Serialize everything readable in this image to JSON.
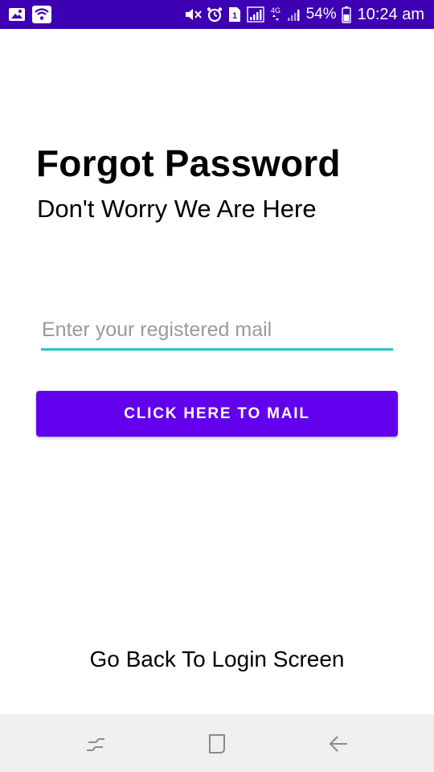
{
  "status_bar": {
    "battery_percent": "54%",
    "time": "10:24 am",
    "sim_number": "1",
    "network_type": "4G",
    "icons": [
      "image-icon",
      "wifi-icon",
      "mute-icon",
      "alarm-icon",
      "sim-icon",
      "signal-icon",
      "lte-icon",
      "signal-icon",
      "battery-icon"
    ]
  },
  "header": {
    "title": "Forgot Password",
    "subtitle": "Don't Worry We Are Here"
  },
  "form": {
    "email_placeholder": "Enter your registered mail",
    "email_value": "",
    "submit_label": "Click Here To Mail"
  },
  "footer": {
    "back_link": "Go Back To Login Screen"
  },
  "nav_bar": {
    "buttons": [
      "recent-apps-icon",
      "home-icon",
      "back-icon"
    ]
  },
  "colors": {
    "status_bar": "#3d00b3",
    "accent": "#6200ee",
    "input_underline": "#26c6c1",
    "nav_bar": "#efefef"
  }
}
